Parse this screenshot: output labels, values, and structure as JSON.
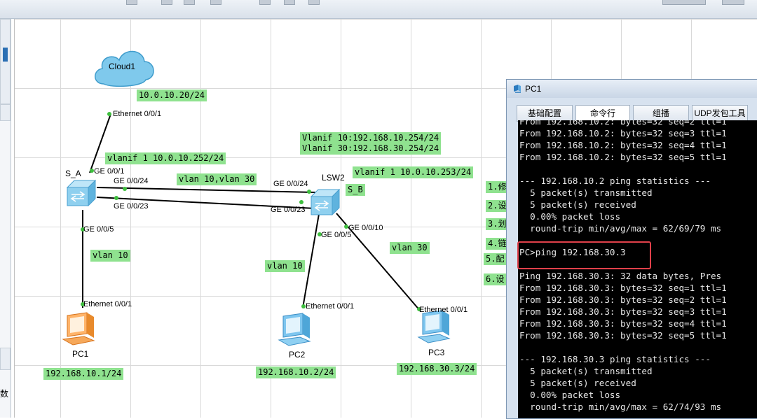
{
  "colors": {
    "note_bg": "#8fe28f",
    "terminal_bg": "#000000",
    "terminal_fg": "#e6e6e6",
    "highlight": "#e0404a",
    "link": "#000000",
    "port_dot": "#3fbf3f"
  },
  "devices": {
    "cloud": {
      "label": "Cloud1",
      "icon": "cloud-icon"
    },
    "switch_a": {
      "label": "S_A",
      "icon": "switch-icon"
    },
    "switch_b": {
      "label": "LSW2",
      "icon": "switch-icon"
    },
    "pc1": {
      "label": "PC1",
      "icon": "pc-icon"
    },
    "pc2": {
      "label": "PC2",
      "icon": "pc-icon"
    },
    "pc3": {
      "label": "PC3",
      "icon": "pc-icon"
    }
  },
  "ports": {
    "cloud_eth": "Ethernet 0/0/1",
    "sa_ge001": "GE 0/0/1",
    "sa_ge0024": "GE 0/0/24",
    "sa_ge0023": "GE 0/0/23",
    "sa_ge005": "GE 0/0/5",
    "pc1_eth": "Ethernet 0/0/1",
    "sb_ge0024": "GE 0/0/24",
    "sb_ge0023": "GE 0/0/23",
    "sb_ge005": "GE 0/0/5",
    "sb_ge0010": "GE 0/0/10",
    "pc2_eth": "Ethernet 0/0/1",
    "pc3_eth": "Ethernet 0/0/1"
  },
  "notes": {
    "cloud_ip": "10.0.10.20/24",
    "sa_vlanif1": "vlanif 1 10.0.10.252/24",
    "trunk_vlans": "vlan 10,vlan 30",
    "sb_vlanif_10_30": "Vlanif 10:192.168.10.254/24\nVlanif 30:192.168.30.254/24",
    "sb_vlanif1": "vlanif 1 10.0.10.253/24",
    "sb_name": "S_B",
    "pc1_vlan": "vlan 10",
    "pc2_vlan": "vlan 10",
    "pc3_vlan": "vlan 30",
    "pc1_ip": "192.168.10.1/24",
    "pc2_ip": "192.168.10.2/24",
    "pc3_ip": "192.168.30.3/24",
    "step1": "1.修",
    "step2": "2.设",
    "step3": "3.划",
    "step4": "4.链",
    "step5": "5.配",
    "step6": "6.设"
  },
  "left_panel": {
    "bottom_char": "数"
  },
  "pc1_window": {
    "title": "PC1",
    "tabs": [
      "基础配置",
      "命令行",
      "组播",
      "UDP发包工具"
    ],
    "active_tab": "命令行",
    "terminal_lines": [
      "From 192.168.10.2: bytes=32 seq=2 ttl=1",
      "From 192.168.10.2: bytes=32 seq=3 ttl=1",
      "From 192.168.10.2: bytes=32 seq=4 ttl=1",
      "From 192.168.10.2: bytes=32 seq=5 ttl=1",
      "",
      "--- 192.168.10.2 ping statistics ---",
      "  5 packet(s) transmitted",
      "  5 packet(s) received",
      "  0.00% packet loss",
      "  round-trip min/avg/max = 62/69/79 ms",
      "",
      "PC>ping 192.168.30.3",
      "",
      "Ping 192.168.30.3: 32 data bytes, Pres",
      "From 192.168.30.3: bytes=32 seq=1 ttl=1",
      "From 192.168.30.3: bytes=32 seq=2 ttl=1",
      "From 192.168.30.3: bytes=32 seq=3 ttl=1",
      "From 192.168.30.3: bytes=32 seq=4 ttl=1",
      "From 192.168.30.3: bytes=32 seq=5 ttl=1",
      "",
      "--- 192.168.30.3 ping statistics ---",
      "  5 packet(s) transmitted",
      "  5 packet(s) received",
      "  0.00% packet loss",
      "  round-trip min/avg/max = 62/74/93 ms"
    ]
  }
}
